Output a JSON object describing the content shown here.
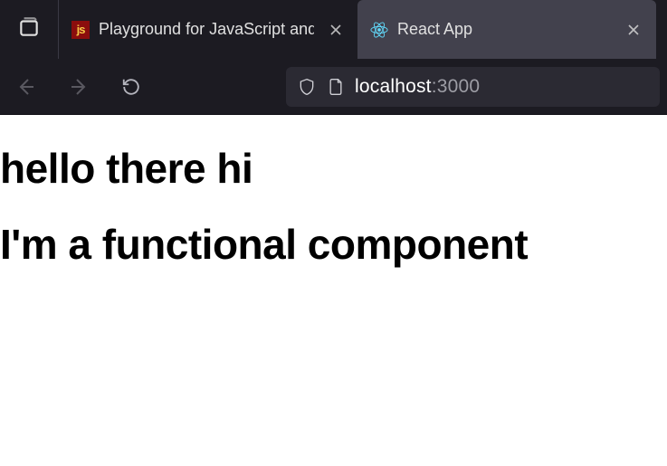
{
  "tabs": [
    {
      "title": "Playground for JavaScript and R",
      "favicon": "js",
      "active": false
    },
    {
      "title": "React App",
      "favicon": "react",
      "active": true
    }
  ],
  "address": {
    "host": "localhost",
    "port": ":3000"
  },
  "page": {
    "heading1": "hello there hi",
    "heading2": "I'm a functional component"
  }
}
